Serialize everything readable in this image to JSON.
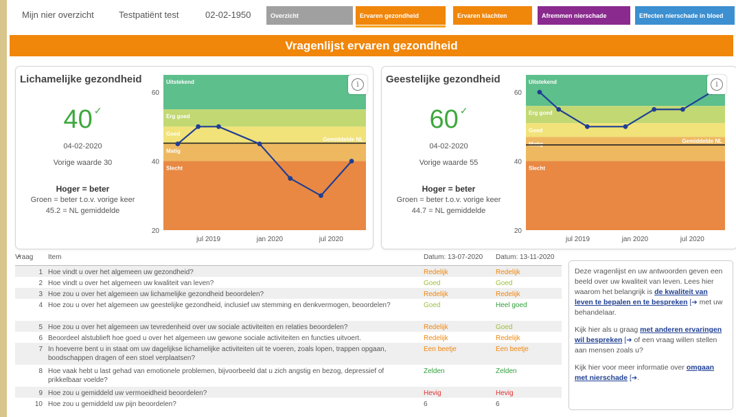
{
  "topbar": {
    "app_title": "Mijn nier overzicht",
    "patient_name": "Testpatiënt test",
    "birth_date": "02-02-1950"
  },
  "nav": [
    {
      "label": "Overzicht",
      "color": "#a0a0a0"
    },
    {
      "label": "Ervaren gezondheid",
      "color": "#f0860a",
      "active": true
    },
    {
      "label": "Ervaren klachten",
      "color": "#f0860a"
    },
    {
      "label": "Afremmen nierschade",
      "color": "#8a2a8e"
    },
    {
      "label": "Effecten nierschade in bloed",
      "color": "#3c8fd0"
    }
  ],
  "banner": "Vragenlijst ervaren gezondheid",
  "physical": {
    "title": "Lichamelijke gezondheid",
    "score": "40",
    "date": "04-02-2020",
    "previous": "Vorige waarde 30",
    "higher": "Hoger = beter",
    "green_text": "Groen = beter t.o.v. vorige keer",
    "nl_text": "45.2 = NL gemiddelde"
  },
  "mental": {
    "title": "Geestelijke gezondheid",
    "score": "60",
    "date": "04-02-2020",
    "previous": "Vorige waarde 55",
    "higher": "Hoger = beter",
    "green_text": "Groen = beter t.o.v. vorige keer",
    "nl_text": "44.7 = NL gemiddelde"
  },
  "chart_data": [
    {
      "type": "line",
      "ylim": [
        20,
        65
      ],
      "yticks": [
        "60",
        "40",
        "20"
      ],
      "xticks": [
        "jul 2019",
        "jan 2020",
        "jul 2020"
      ],
      "bands": [
        {
          "label": "Uitstekend",
          "from": 55,
          "to": 65,
          "color": "#5dbf8c"
        },
        {
          "label": "Erg goed",
          "from": 50,
          "to": 55,
          "color": "#c2d873"
        },
        {
          "label": "Goed",
          "from": 45,
          "to": 50,
          "color": "#f1e279"
        },
        {
          "label": "Matig",
          "from": 40,
          "to": 45,
          "color": "#eeb860"
        },
        {
          "label": "Slecht",
          "from": 20,
          "to": 40,
          "color": "#e88843"
        }
      ],
      "reference": {
        "label": "Gemiddelde NL",
        "value": 45.2
      },
      "x": [
        "2019-04",
        "2019-06",
        "2019-08",
        "2019-12",
        "2020-03",
        "2020-06",
        "2020-09"
      ],
      "series": [
        {
          "values": [
            45,
            50,
            50,
            45,
            35,
            30,
            40
          ],
          "color": "#1f3f93"
        }
      ]
    },
    {
      "type": "line",
      "ylim": [
        20,
        65
      ],
      "yticks": [
        "60",
        "40",
        "20"
      ],
      "xticks": [
        "jul 2019",
        "jan 2020",
        "jul 2020"
      ],
      "bands": [
        {
          "label": "Uitstekend",
          "from": 56,
          "to": 65,
          "color": "#5dbf8c"
        },
        {
          "label": "Erg goed",
          "from": 51,
          "to": 56,
          "color": "#c2d873"
        },
        {
          "label": "Goed",
          "from": 47,
          "to": 51,
          "color": "#f1e279"
        },
        {
          "label": "Matig",
          "from": 40,
          "to": 47,
          "color": "#eeb860"
        },
        {
          "label": "Slecht",
          "from": 20,
          "to": 40,
          "color": "#e88843"
        }
      ],
      "reference": {
        "label": "Gemiddelde NL",
        "value": 44.7
      },
      "x": [
        "2019-03",
        "2019-05",
        "2019-08",
        "2019-12",
        "2020-03",
        "2020-06",
        "2020-09"
      ],
      "series": [
        {
          "values": [
            60,
            55,
            50,
            50,
            55,
            55,
            60
          ],
          "color": "#1f3f93"
        }
      ]
    }
  ],
  "table": {
    "col_vraag": "Vraag",
    "col_item": "Item",
    "col_date1": "Datum: 13-07-2020",
    "col_date2": "Datum: 13-11-2020",
    "rows": [
      {
        "n": "1",
        "q": "Hoe vindt u over het algemeen uw gezondheid?",
        "a1": "Redelijk",
        "c1": "#f0860a",
        "a2": "Redelijk",
        "c2": "#f0860a"
      },
      {
        "n": "2",
        "q": "Hoe vindt u over het algemeen uw kwaliteit van leven?",
        "a1": "Goed",
        "c1": "#9cbf3a",
        "a2": "Goed",
        "c2": "#9cbf3a"
      },
      {
        "n": "3",
        "q": "Hoe zou u over het algemeen uw lichamelijke gezondheid beoordelen?",
        "a1": "Redelijk",
        "c1": "#f0860a",
        "a2": "Redelijk",
        "c2": "#f0860a"
      },
      {
        "n": "4",
        "q": "Hoe zou u over het algemeen uw geestelijke gezondheid, inclusief uw stemming en denkvermogen, beoordelen?",
        "a1": "Goed",
        "c1": "#9cbf3a",
        "a2": "Heel goed",
        "c2": "#2f9e3a"
      },
      {
        "n": "5",
        "q": "Hoe zou u over het algemeen uw tevredenheid over uw sociale activiteiten en relaties beoordelen?",
        "a1": "Redelijk",
        "c1": "#f0860a",
        "a2": "Goed",
        "c2": "#9cbf3a"
      },
      {
        "n": "6",
        "q": "Beoordeel alstublieft hoe goed u over het algemeen uw gewone sociale activiteiten en functies uitvoert.",
        "a1": "Redelijk",
        "c1": "#f0860a",
        "a2": "Redelijk",
        "c2": "#f0860a"
      },
      {
        "n": "7",
        "q": "In hoeverre bent u in staat om uw dagelijkse lichamelijke activiteiten uit te voeren, zoals lopen, trappen opgaan, boodschappen dragen of een stoel verplaatsen?",
        "a1": "Een beetje",
        "c1": "#f0860a",
        "a2": "Een beetje",
        "c2": "#f0860a"
      },
      {
        "n": "8",
        "q": "Hoe vaak hebt u last gehad van emotionele problemen, bijvoorbeeld dat u zich angstig en bezog, depressief of prikkelbaar voelde?",
        "a1": "Zelden",
        "c1": "#2f9e3a",
        "a2": "Zelden",
        "c2": "#2f9e3a"
      },
      {
        "n": "9",
        "q": "Hoe zou u gemiddeld uw vermoeidheid beoordelen?",
        "a1": "Hevig",
        "c1": "#e03030",
        "a2": "Hevig",
        "c2": "#e03030"
      },
      {
        "n": "10",
        "q": "Hoe zou u gemiddeld uw pijn beoordelen?",
        "a1": "6",
        "c1": "#555555",
        "a2": "6",
        "c2": "#555555"
      }
    ]
  },
  "sidebox": {
    "p1_text": "Deze vragenlijst en uw antwoorden geven een beeld over uw kwaliteit van leven. Lees hier waarom het belangrijk is",
    "p1_link": "de kwaliteit van leven te bepalen en te bespreken",
    "p1_after": "met uw behandelaar.",
    "p2_text": "Kijk hier als u graag",
    "p2_link": "met anderen ervaringen wil bespreken",
    "p2_after": "of een vraag willen stellen aan mensen zoals u?",
    "p3_text": "Kijk hier voor meer informatie over",
    "p3_link": "omgaan met nierschade",
    "p3_after": "."
  }
}
